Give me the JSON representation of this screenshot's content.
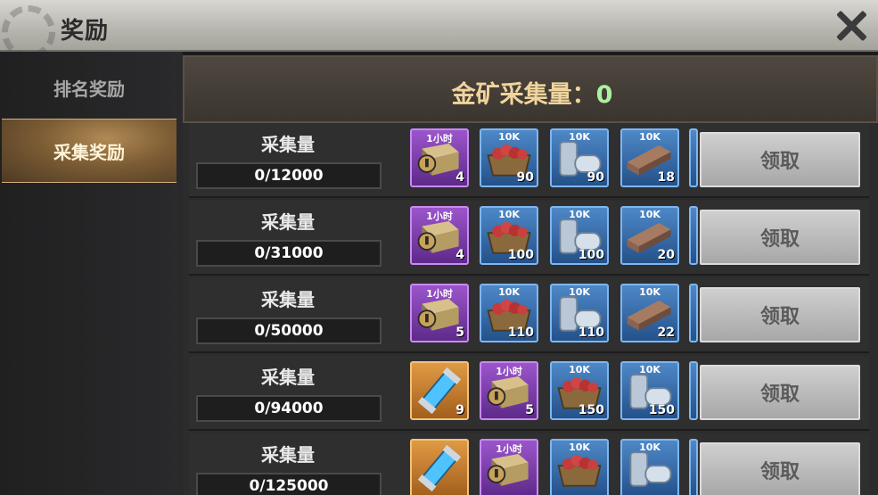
{
  "window": {
    "title": "奖励",
    "close_icon": "close-icon"
  },
  "sidebar": {
    "items": [
      {
        "label": "排名奖励"
      },
      {
        "label": "采集奖励"
      }
    ]
  },
  "header": {
    "label": "金矿采集量：",
    "value": "0"
  },
  "rows": [
    {
      "label": "采集量",
      "progress": "0/12000",
      "claim": "领取",
      "items": [
        {
          "tag": "1小时",
          "qty": "4",
          "icon": "speedup-chest-icon",
          "color": "purple"
        },
        {
          "tag": "10K",
          "qty": "90",
          "icon": "food-crate-icon",
          "color": "blue"
        },
        {
          "tag": "10K",
          "qty": "90",
          "icon": "oil-canister-icon",
          "color": "blue"
        },
        {
          "tag": "10K",
          "qty": "18",
          "icon": "steel-beam-icon",
          "color": "blue"
        }
      ]
    },
    {
      "label": "采集量",
      "progress": "0/31000",
      "claim": "领取",
      "items": [
        {
          "tag": "1小时",
          "qty": "4",
          "icon": "speedup-chest-icon",
          "color": "purple"
        },
        {
          "tag": "10K",
          "qty": "100",
          "icon": "food-crate-icon",
          "color": "blue"
        },
        {
          "tag": "10K",
          "qty": "100",
          "icon": "oil-canister-icon",
          "color": "blue"
        },
        {
          "tag": "10K",
          "qty": "20",
          "icon": "steel-beam-icon",
          "color": "blue"
        }
      ]
    },
    {
      "label": "采集量",
      "progress": "0/50000",
      "claim": "领取",
      "items": [
        {
          "tag": "1小时",
          "qty": "5",
          "icon": "speedup-chest-icon",
          "color": "purple"
        },
        {
          "tag": "10K",
          "qty": "110",
          "icon": "food-crate-icon",
          "color": "blue"
        },
        {
          "tag": "10K",
          "qty": "110",
          "icon": "oil-canister-icon",
          "color": "blue"
        },
        {
          "tag": "10K",
          "qty": "22",
          "icon": "steel-beam-icon",
          "color": "blue"
        }
      ]
    },
    {
      "label": "采集量",
      "progress": "0/94000",
      "claim": "领取",
      "items": [
        {
          "tag": "",
          "qty": "9",
          "icon": "energy-vial-icon",
          "color": "orange"
        },
        {
          "tag": "1小时",
          "qty": "5",
          "icon": "speedup-chest-icon",
          "color": "purple"
        },
        {
          "tag": "10K",
          "qty": "150",
          "icon": "food-crate-icon",
          "color": "blue"
        },
        {
          "tag": "10K",
          "qty": "150",
          "icon": "oil-canister-icon",
          "color": "blue"
        }
      ]
    },
    {
      "label": "采集量",
      "progress": "0/125000",
      "claim": "领取",
      "items": [
        {
          "tag": "",
          "qty": "",
          "icon": "energy-vial-icon",
          "color": "orange"
        },
        {
          "tag": "1小时",
          "qty": "",
          "icon": "speedup-chest-icon",
          "color": "purple"
        },
        {
          "tag": "10K",
          "qty": "",
          "icon": "food-crate-icon",
          "color": "blue"
        },
        {
          "tag": "10K",
          "qty": "",
          "icon": "oil-canister-icon",
          "color": "blue"
        }
      ]
    }
  ]
}
